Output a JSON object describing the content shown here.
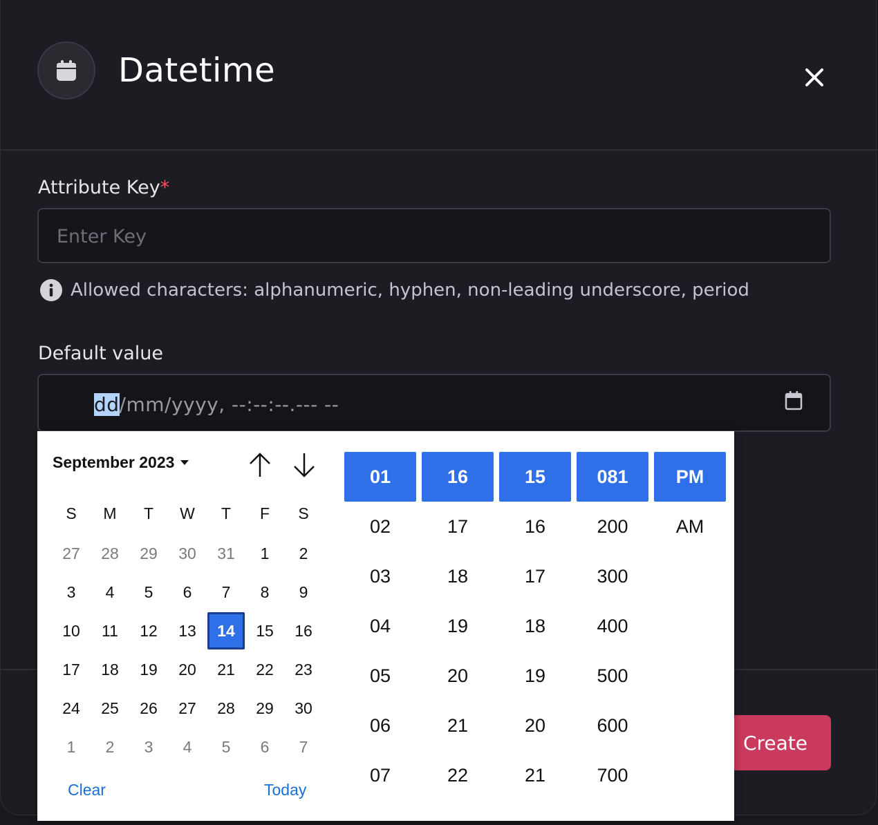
{
  "header": {
    "title": "Datetime",
    "icon": "calendar-icon",
    "close": "close-icon"
  },
  "form": {
    "key_label": "Attribute Key",
    "key_required": "*",
    "key_placeholder": "Enter Key",
    "hint": "Allowed characters: alphanumeric, hyphen, non-leading underscore, period",
    "default_label": "Default value",
    "datetime_selected_segment": "dd",
    "datetime_rest": "/mm/yyyy, --:--:--.--- --"
  },
  "footer": {
    "create_label": "Create"
  },
  "picker": {
    "month_label": "September 2023",
    "weekdays": [
      "S",
      "M",
      "T",
      "W",
      "T",
      "F",
      "S"
    ],
    "weeks": [
      [
        "27",
        "28",
        "29",
        "30",
        "31",
        "1",
        "2"
      ],
      [
        "3",
        "4",
        "5",
        "6",
        "7",
        "8",
        "9"
      ],
      [
        "10",
        "11",
        "12",
        "13",
        "14",
        "15",
        "16"
      ],
      [
        "17",
        "18",
        "19",
        "20",
        "21",
        "22",
        "23"
      ],
      [
        "24",
        "25",
        "26",
        "27",
        "28",
        "29",
        "30"
      ],
      [
        "1",
        "2",
        "3",
        "4",
        "5",
        "6",
        "7"
      ]
    ],
    "selected_day": "14",
    "clear_label": "Clear",
    "today_label": "Today",
    "hours": [
      "01",
      "02",
      "03",
      "04",
      "05",
      "06",
      "07"
    ],
    "minutes": [
      "16",
      "17",
      "18",
      "19",
      "20",
      "21",
      "22"
    ],
    "seconds": [
      "15",
      "16",
      "17",
      "18",
      "19",
      "20",
      "21"
    ],
    "millis": [
      "081",
      "200",
      "300",
      "400",
      "500",
      "600",
      "700"
    ],
    "ampm": [
      "PM",
      "AM"
    ]
  },
  "colors": {
    "accent": "#2f6fe8",
    "create": "#c93a5c",
    "required": "#ff4d5e"
  }
}
